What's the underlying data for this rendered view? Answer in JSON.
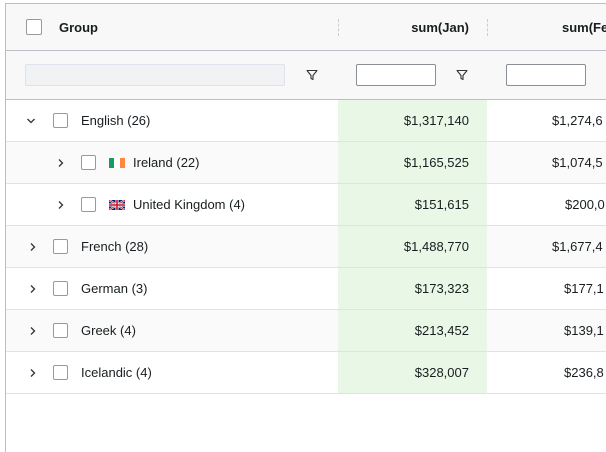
{
  "header": {
    "group_label": "Group",
    "col_jan": "sum(Jan)",
    "col_feb": "sum(Fe"
  },
  "rows": [
    {
      "label": "English (26)",
      "jan": "$1,317,140",
      "feb": "$1,274,6"
    },
    {
      "label": "Ireland (22)",
      "jan": "$1,165,525",
      "feb": "$1,074,5"
    },
    {
      "label": "United Kingdom (4)",
      "jan": "$151,615",
      "feb": "$200,0"
    },
    {
      "label": "French (28)",
      "jan": "$1,488,770",
      "feb": "$1,677,4"
    },
    {
      "label": "German (3)",
      "jan": "$173,323",
      "feb": "$177,1"
    },
    {
      "label": "Greek (4)",
      "jan": "$213,452",
      "feb": "$139,1"
    },
    {
      "label": "Icelandic (4)",
      "jan": "$328,007",
      "feb": "$236,8"
    }
  ],
  "colors": {
    "jan_column_bg": "#e9f8e6",
    "border": "#babfc7",
    "header_bg": "#f8f8f8"
  }
}
